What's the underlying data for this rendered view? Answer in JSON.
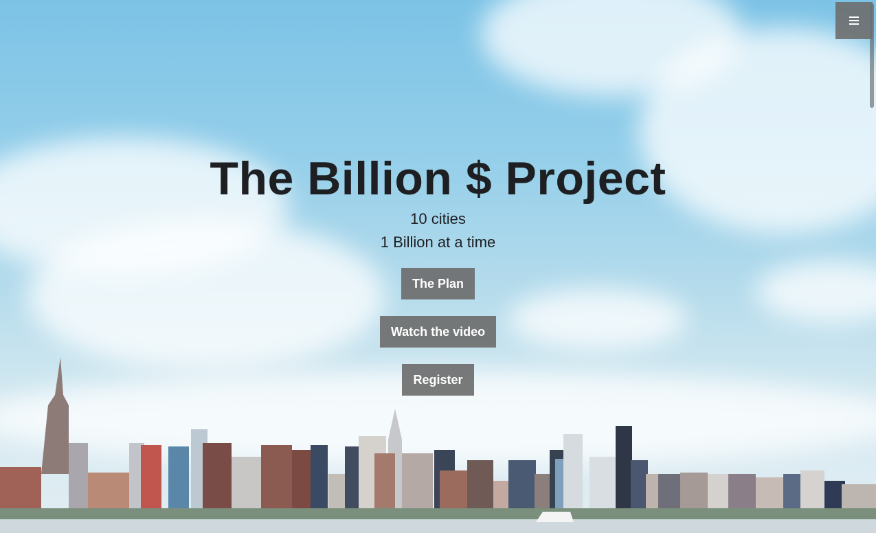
{
  "hero": {
    "title": "The Billion $ Project",
    "subtitle_lines": [
      "10 cities",
      "1 Billion at a time"
    ],
    "background_image": "city-skyline-sky"
  },
  "buttons": {
    "plan_label": "The Plan",
    "video_label": "Watch the video",
    "register_label": "Register"
  },
  "menu": {
    "icon": "hamburger-icon"
  },
  "colors": {
    "text": "#1e1f22",
    "button_bg": "#6e6e6e",
    "button_text": "#ffffff",
    "sky": "#7cc3e6"
  }
}
